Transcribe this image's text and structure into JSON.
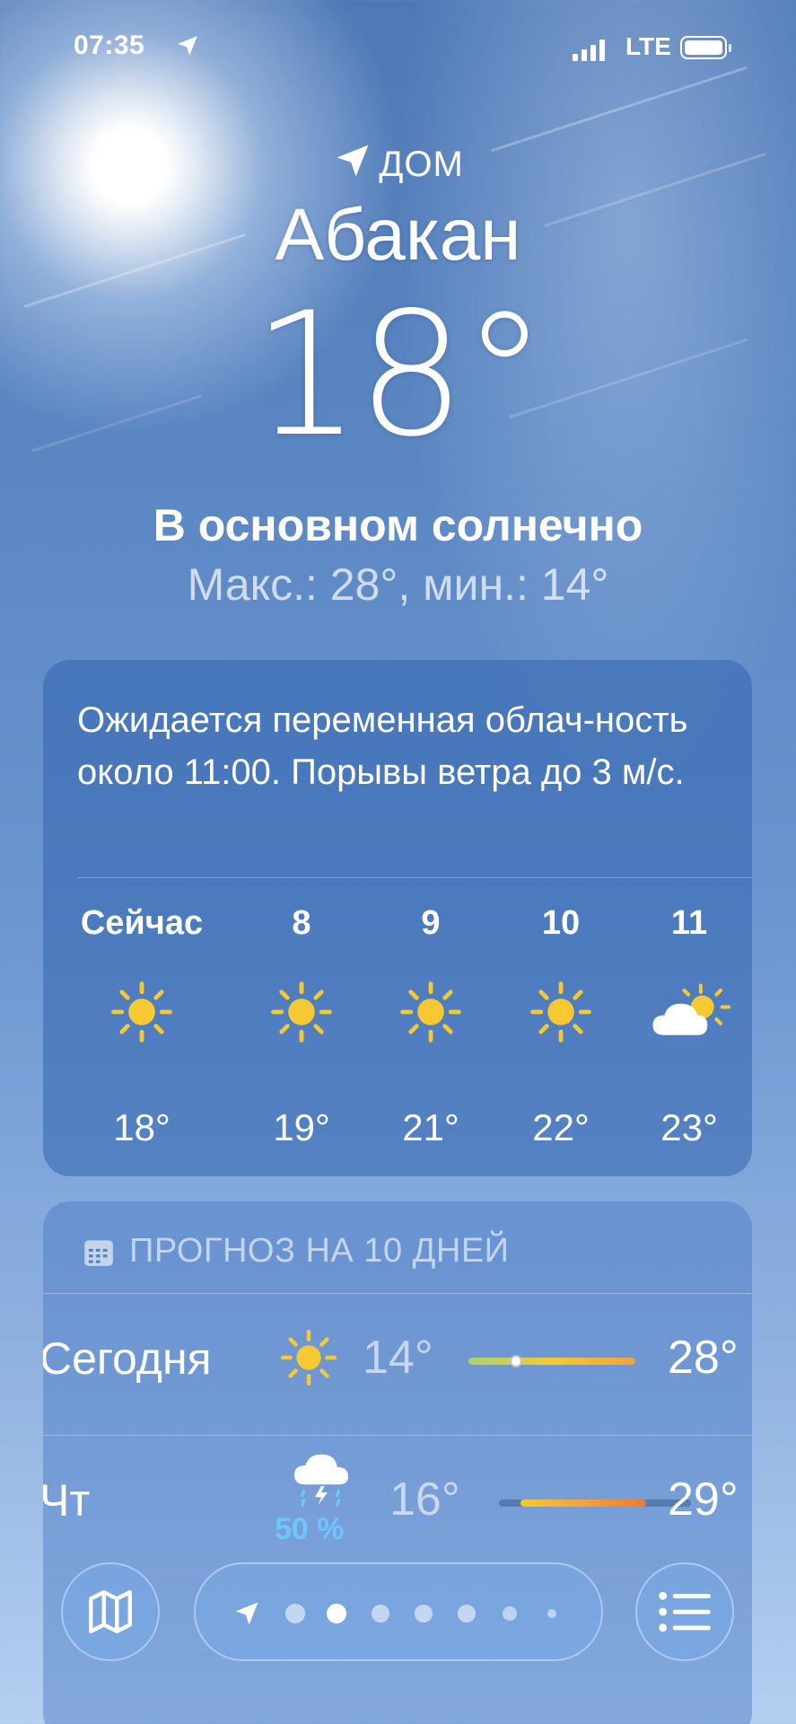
{
  "status_bar": {
    "time": "07:35",
    "network": "LTE"
  },
  "header": {
    "location_label": "ДОМ",
    "city": "Абакан",
    "temperature": "18°",
    "condition": "В основном солнечно",
    "high_low": "Макс.: 28°, мин.: 14°"
  },
  "hourly": {
    "summary": "Ожидается переменная облач-ность около 11:00. Порывы ветра до 3 м/с.",
    "items": [
      {
        "label": "Сейчас",
        "icon": "sun-icon",
        "temp": "18°"
      },
      {
        "label": "8",
        "icon": "sun-icon",
        "temp": "19°"
      },
      {
        "label": "9",
        "icon": "sun-icon",
        "temp": "21°"
      },
      {
        "label": "10",
        "icon": "sun-icon",
        "temp": "22°"
      },
      {
        "label": "11",
        "icon": "partly-cloudy-icon",
        "temp": "23°"
      }
    ]
  },
  "daily": {
    "title": "ПРОГНОЗ НА 10 ДНЕЙ",
    "days": [
      {
        "name": "Сегодня",
        "icon": "sun-icon",
        "low": "14°",
        "high": "28°",
        "precip": ""
      },
      {
        "name": "Чт",
        "icon": "thunderstorm-icon",
        "low": "16°",
        "high": "29°",
        "precip": "50 %"
      }
    ]
  },
  "colors": {
    "sun": "#f6c933",
    "bar_cool": "#a8d46a",
    "bar_warm": "#f3a23a",
    "precip": "#6ec6ff"
  },
  "pager": {
    "pages": 7,
    "current": 1
  }
}
